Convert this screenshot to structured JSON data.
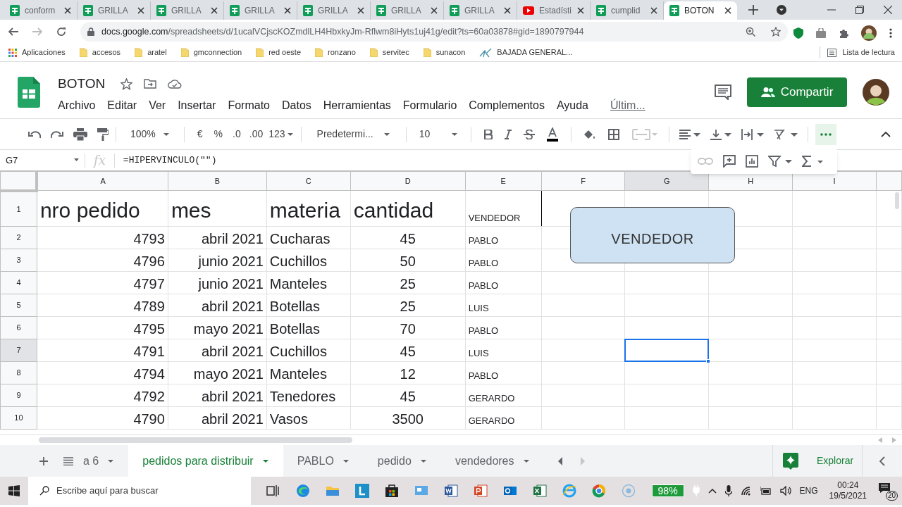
{
  "browser": {
    "tabs": [
      {
        "label": "conform",
        "kind": "spreadsheet",
        "selected": false
      },
      {
        "label": "GRILLA",
        "kind": "spreadsheet",
        "selected": false
      },
      {
        "label": "GRILLA",
        "kind": "spreadsheet",
        "selected": false
      },
      {
        "label": "GRILLA",
        "kind": "spreadsheet",
        "selected": false
      },
      {
        "label": "GRILLA",
        "kind": "spreadsheet",
        "selected": false
      },
      {
        "label": "GRILLA",
        "kind": "spreadsheet",
        "selected": false
      },
      {
        "label": "GRILLA",
        "kind": "spreadsheet",
        "selected": false
      },
      {
        "label": "Estadísti",
        "kind": "video",
        "selected": false
      },
      {
        "label": "cumplid",
        "kind": "spreadsheet",
        "selected": false
      },
      {
        "label": "BOTON",
        "kind": "spreadsheet",
        "selected": true
      }
    ],
    "url_host": "docs.google.com",
    "url_path": "/spreadsheets/d/1ucalVCjscKOZmdlLH4HbxkyJm-Rflwm8iHyts1uj41g/edit?ts=60a03878#gid=1890797944",
    "bookmarks": [
      {
        "label": "Aplicaciones",
        "kind": "apps"
      },
      {
        "label": "accesos",
        "kind": "folder"
      },
      {
        "label": "aratel",
        "kind": "folder"
      },
      {
        "label": "gmconnection",
        "kind": "folder"
      },
      {
        "label": "red oeste",
        "kind": "folder"
      },
      {
        "label": "ronzano",
        "kind": "folder"
      },
      {
        "label": "servitec",
        "kind": "folder"
      },
      {
        "label": "sunacon",
        "kind": "folder"
      },
      {
        "label": "BAJADA GENERAL...",
        "kind": "site"
      }
    ],
    "reading_list": "Lista de lectura"
  },
  "sheets": {
    "title": "BOTON",
    "menu": [
      "Archivo",
      "Editar",
      "Ver",
      "Insertar",
      "Formato",
      "Datos",
      "Herramientas",
      "Formulario",
      "Complementos",
      "Ayuda"
    ],
    "last_edit": "Últim...",
    "share_button": "Compartir"
  },
  "toolbar": {
    "zoom": "100%",
    "currency": "€",
    "percent": "%",
    "decrease_decimals": ".0",
    "increase_decimals": ".00",
    "number_format": "123",
    "font": "Predetermi...",
    "font_size": "10"
  },
  "formula_bar": {
    "cell_ref": "G7",
    "function_label": "fx",
    "formula": "=HIPERVINCULO(\"\")"
  },
  "grid": {
    "columns": [
      {
        "label": "A",
        "selected": false
      },
      {
        "label": "B",
        "selected": false
      },
      {
        "label": "C",
        "selected": false
      },
      {
        "label": "D",
        "selected": false
      },
      {
        "label": "E",
        "selected": false
      },
      {
        "label": "F",
        "selected": false
      },
      {
        "label": "G",
        "selected": true
      },
      {
        "label": "H",
        "selected": false
      },
      {
        "label": "I",
        "selected": false
      }
    ],
    "rows": [
      {
        "number": "1",
        "selected": false,
        "cells": [
          "nro pedido",
          "mes",
          "materia",
          "cantidad",
          "VENDEDOR"
        ]
      },
      {
        "number": "2",
        "selected": false,
        "cells": [
          "4793",
          "abril 2021",
          "Cucharas",
          "45",
          "PABLO"
        ]
      },
      {
        "number": "3",
        "selected": false,
        "cells": [
          "4796",
          "junio 2021",
          "Cuchillos",
          "50",
          "PABLO"
        ]
      },
      {
        "number": "4",
        "selected": false,
        "cells": [
          "4797",
          "junio 2021",
          "Manteles",
          "25",
          "PABLO"
        ]
      },
      {
        "number": "5",
        "selected": false,
        "cells": [
          "4789",
          "abril 2021",
          "Botellas",
          "25",
          "LUIS"
        ]
      },
      {
        "number": "6",
        "selected": false,
        "cells": [
          "4795",
          "mayo 2021",
          "Botellas",
          "70",
          "PABLO"
        ]
      },
      {
        "number": "7",
        "selected": true,
        "cells": [
          "4791",
          "abril 2021",
          "Cuchillos",
          "45",
          "LUIS"
        ]
      },
      {
        "number": "8",
        "selected": false,
        "cells": [
          "4794",
          "mayo 2021",
          "Manteles",
          "12",
          "PABLO"
        ]
      },
      {
        "number": "9",
        "selected": false,
        "cells": [
          "4792",
          "abril 2021",
          "Tenedores",
          "45",
          "GERARDO"
        ]
      },
      {
        "number": "10",
        "selected": false,
        "cells": [
          "4790",
          "abril 2021",
          "Vasos",
          "3500",
          "GERARDO"
        ]
      }
    ],
    "shape_button": "VENDEDOR"
  },
  "sheet_tabs": [
    {
      "label": "a 6",
      "selected": false
    },
    {
      "label": "pedidos para distribuir",
      "selected": true
    },
    {
      "label": "PABLO",
      "selected": false
    },
    {
      "label": "pedido",
      "selected": false
    },
    {
      "label": "vendedores",
      "selected": false
    }
  ],
  "explore_button": "Explorar",
  "taskbar": {
    "search_placeholder": "Escribe aquí para buscar",
    "battery": "98%",
    "language": "ENG",
    "time": "00:24",
    "date": "19/5/2021",
    "notifications": "20"
  }
}
